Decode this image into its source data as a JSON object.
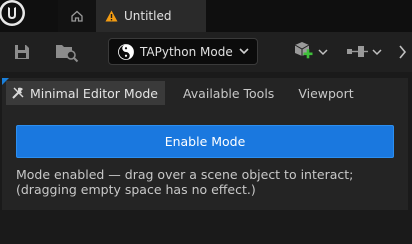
{
  "tabs": {
    "home_icon": "home-icon",
    "document": {
      "title": "Untitled",
      "icon": "warning-icon"
    }
  },
  "toolbar": {
    "save_icon": "save-icon",
    "browse_icon": "content-browser-icon",
    "mode_button": {
      "label": "TAPython Mode",
      "icon": "yin-yang-icon"
    },
    "add_actor_icon": "add-actor-icon",
    "blueprint_icon": "blueprint-icon",
    "more_icon": "chevron-right-icon",
    "accent_color": "#1a78df"
  },
  "panel": {
    "tabs": [
      {
        "label": "Minimal Editor Mode",
        "icon": "tools-icon",
        "active": true
      },
      {
        "label": "Available Tools",
        "active": false
      },
      {
        "label": "Viewport",
        "active": false
      }
    ],
    "enable_button_label": "Enable Mode",
    "status_line_1": "Mode enabled — drag over a scene object to interact;",
    "status_line_2": "(dragging empty space has no effect.)"
  }
}
